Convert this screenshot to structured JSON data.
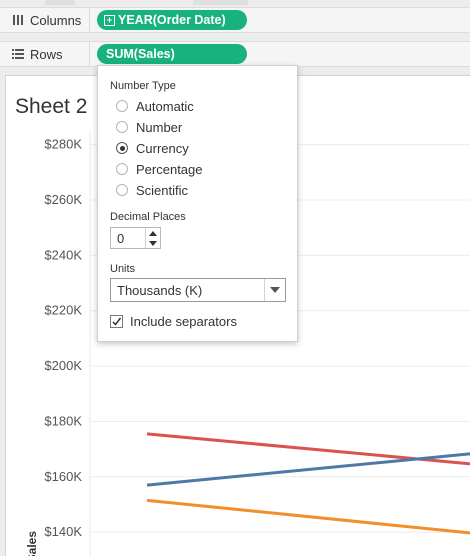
{
  "shelves": {
    "columns": {
      "label": "Columns",
      "icon": "columns-icon",
      "pill": "YEAR(Order Date)"
    },
    "rows": {
      "label": "Rows",
      "icon": "rows-icon",
      "pill": "SUM(Sales)"
    }
  },
  "sheet": {
    "title": "Sheet 2"
  },
  "chart_data": {
    "type": "line",
    "ylabel": "Sales",
    "ylim": [
      135000,
      290000
    ],
    "y_ticks": [
      "$140K",
      "$160K",
      "$180K",
      "$200K",
      "$220K",
      "$240K",
      "$260K",
      "$280K"
    ],
    "x": [
      0,
      1
    ],
    "series": [
      {
        "color": "#d9534f",
        "values": [
          175500,
          164500
        ]
      },
      {
        "color": "#4e79a7",
        "values": [
          157000,
          168500
        ]
      },
      {
        "color": "#f28e2b",
        "values": [
          151500,
          139500
        ]
      }
    ]
  },
  "format_popup": {
    "number_type_label": "Number Type",
    "options": [
      "Automatic",
      "Number",
      "Currency",
      "Percentage",
      "Scientific"
    ],
    "selected": "Currency",
    "decimal_places_label": "Decimal Places",
    "decimal_places_value": "0",
    "units_label": "Units",
    "units_value": "Thousands (K)",
    "include_separators_label": "Include separators",
    "include_separators_checked": true
  },
  "colors": {
    "pill": "#18b27d"
  }
}
